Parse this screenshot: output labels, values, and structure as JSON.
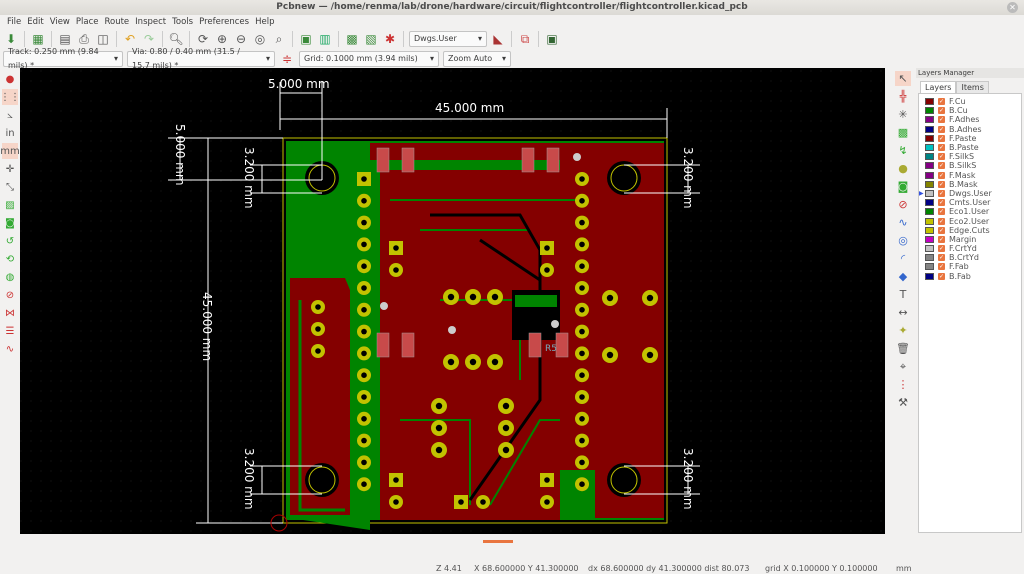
{
  "window": {
    "title": "Pcbnew — /home/renma/lab/drone/hardware/circuit/flightcontroller/flightcontroller.kicad_pcb"
  },
  "menu": [
    "File",
    "Edit",
    "View",
    "Place",
    "Route",
    "Inspect",
    "Tools",
    "Preferences",
    "Help"
  ],
  "toolbar": {
    "layer_select": "Dwgs.User",
    "track": "Track: 0.250 mm (9.84 mils) *",
    "via": "Via: 0.80 / 0.40 mm (31.5 / 15.7 mils) *",
    "grid": "Grid: 0.1000 mm (3.94 mils)",
    "zoom": "Zoom Auto"
  },
  "dimensions": {
    "top_small": "5.000 mm",
    "top_large": "45.000 mm",
    "left_small": "5.000 mm",
    "left_large": "45.000 mm",
    "hole_spacing": "3.200 mm"
  },
  "refs": {
    "r5": "R5"
  },
  "layers_manager": {
    "title": "Layers Manager",
    "tabs": [
      "Layers",
      "Items"
    ],
    "active_layer": "Dwgs.User",
    "layers": [
      {
        "name": "F.Cu",
        "color": "#840000"
      },
      {
        "name": "B.Cu",
        "color": "#008400"
      },
      {
        "name": "F.Adhes",
        "color": "#840084"
      },
      {
        "name": "B.Adhes",
        "color": "#000084"
      },
      {
        "name": "F.Paste",
        "color": "#840000"
      },
      {
        "name": "B.Paste",
        "color": "#00c2c2"
      },
      {
        "name": "F.SilkS",
        "color": "#008484"
      },
      {
        "name": "B.SilkS",
        "color": "#840084"
      },
      {
        "name": "F.Mask",
        "color": "#840084"
      },
      {
        "name": "B.Mask",
        "color": "#848400"
      },
      {
        "name": "Dwgs.User",
        "color": "#c2c2c2"
      },
      {
        "name": "Cmts.User",
        "color": "#000084"
      },
      {
        "name": "Eco1.User",
        "color": "#008400"
      },
      {
        "name": "Eco2.User",
        "color": "#c2c200"
      },
      {
        "name": "Edge.Cuts",
        "color": "#c2c200"
      },
      {
        "name": "Margin",
        "color": "#c200c2"
      },
      {
        "name": "F.CrtYd",
        "color": "#c2c2c2"
      },
      {
        "name": "B.CrtYd",
        "color": "#848484"
      },
      {
        "name": "F.Fab",
        "color": "#848484"
      },
      {
        "name": "B.Fab",
        "color": "#000084"
      }
    ]
  },
  "status": {
    "zoom": "Z 4.41",
    "pos": "X 68.600000  Y 41.300000",
    "delta": "dx 68.600000  dy 41.300000  dist 80.073",
    "grid": "grid X 0.100000  Y 0.100000",
    "units": "mm"
  }
}
